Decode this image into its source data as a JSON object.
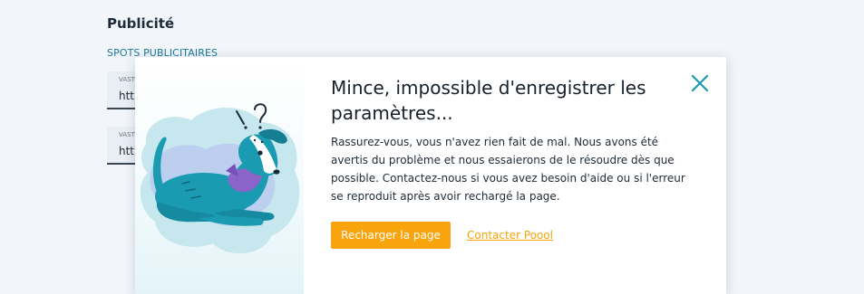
{
  "background": {
    "section_title": "Publicité",
    "section_subtitle": "SPOTS PUBLICITAIRES",
    "fields": [
      {
        "label": "VAST",
        "value": "http"
      },
      {
        "label": "VAST",
        "value": "http"
      }
    ]
  },
  "modal": {
    "title": "Mince, impossible d'enregistrer les paramètres...",
    "body": "Rassurez-vous, vous n'avez rien fait de mal. Nous avons été avertis du problème et nous essaierons de le résoudre dès que possible. Contactez-nous si vous avez besoin d'aide ou si l'erreur se reproduit après avoir rechargé la page.",
    "reload_label": "Recharger la page",
    "contact_label": "Contacter Poool",
    "close_icon": "close-icon",
    "illustration_icon": "confused-dog-illustration"
  },
  "colors": {
    "accent": "#f9a40c",
    "link": "#f5a30a",
    "teal": "#1b9bb1",
    "subtitle": "#1b7a96"
  }
}
